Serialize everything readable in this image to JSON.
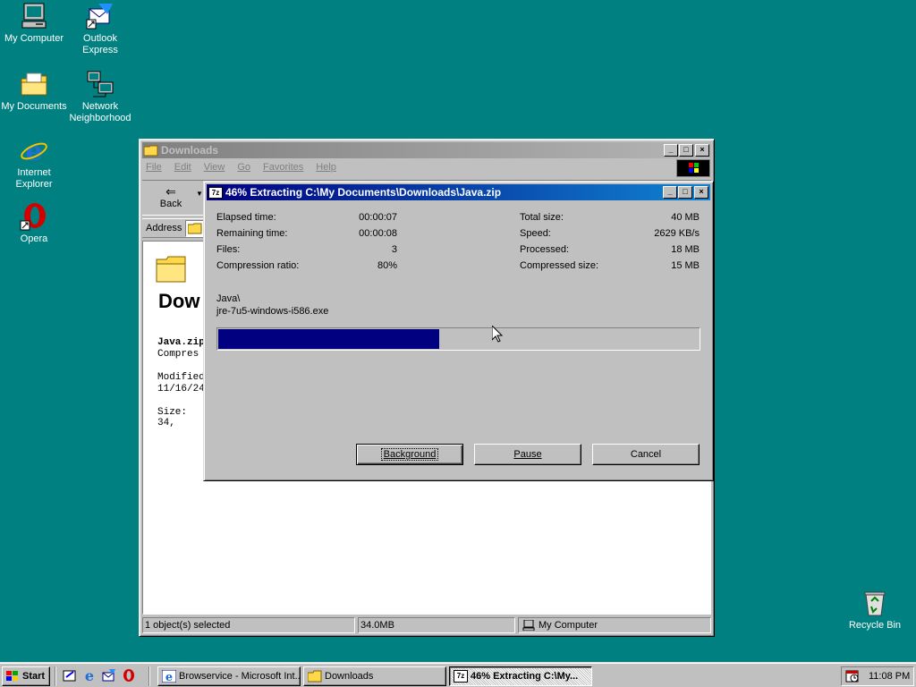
{
  "desktop": {
    "icons": [
      {
        "label": "My Computer"
      },
      {
        "label": "Outlook Express"
      },
      {
        "label": "My Documents"
      },
      {
        "label": "Network Neighborhood"
      },
      {
        "label": "Internet Explorer"
      },
      {
        "label": "Opera"
      },
      {
        "label": "Recycle Bin"
      }
    ]
  },
  "explorer": {
    "title": "Downloads",
    "menu": [
      "File",
      "Edit",
      "View",
      "Go",
      "Favorites",
      "Help"
    ],
    "back_label": "Back",
    "address_label": "Address",
    "folder_heading": "Dow",
    "info": {
      "filename": "Java.zip",
      "type": "Compres",
      "modified_label": "Modified:",
      "modified_value": "11/16/24",
      "size": "Size: 34,"
    },
    "status": {
      "selected": "1 object(s) selected",
      "size": "34.0MB",
      "zone": "My Computer"
    }
  },
  "dialog": {
    "title": "46% Extracting C:\\My Documents\\Downloads\\Java.zip",
    "stats_left": [
      {
        "label": "Elapsed time:",
        "value": "00:00:07"
      },
      {
        "label": "Remaining time:",
        "value": "00:00:08"
      },
      {
        "label": "Files:",
        "value": "3"
      },
      {
        "label": "Compression ratio:",
        "value": "80%"
      }
    ],
    "stats_right": [
      {
        "label": "Total size:",
        "value": "40 MB"
      },
      {
        "label": "Speed:",
        "value": "2629 KB/s"
      },
      {
        "label": "Processed:",
        "value": "18 MB"
      },
      {
        "label": "Compressed size:",
        "value": "15 MB"
      }
    ],
    "current_folder": "Java\\",
    "current_file": "jre-7u5-windows-i586.exe",
    "progress_fraction": 0.46,
    "buttons": {
      "background": "Background",
      "pause": "Pause",
      "cancel": "Cancel"
    }
  },
  "taskbar": {
    "start_label": "Start",
    "tasks": [
      {
        "label": "Browservice - Microsoft Int..."
      },
      {
        "label": "Downloads"
      },
      {
        "label": "46% Extracting C:\\My..."
      }
    ],
    "clock": "11:08 PM"
  },
  "colors": {
    "desktop": "#008080",
    "title_active": "#000080",
    "progress": "#000080"
  }
}
